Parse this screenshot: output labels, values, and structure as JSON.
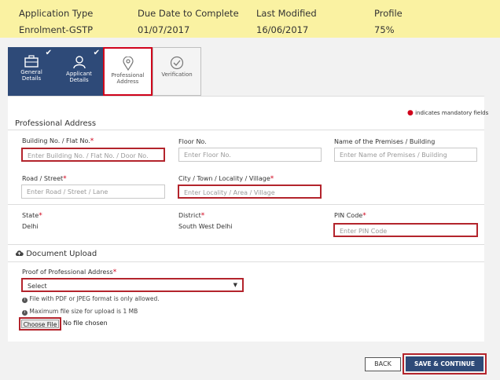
{
  "header": {
    "cols": [
      {
        "label": "Application Type",
        "value": "Enrolment-GSTP"
      },
      {
        "label": "Due Date to Complete",
        "value": "01/07/2017"
      },
      {
        "label": "Last Modified",
        "value": "16/06/2017"
      },
      {
        "label": "Profile",
        "value": "75%"
      }
    ]
  },
  "tabs": [
    {
      "line1": "General",
      "line2": "Details"
    },
    {
      "line1": "Applicant",
      "line2": "Details"
    },
    {
      "line1": "Professional",
      "line2": "Address"
    },
    {
      "line1": "Verification",
      "line2": ""
    }
  ],
  "mandatory_note": "indicates mandatory fields",
  "section_address": "Professional Address",
  "fields": {
    "building": {
      "label": "Building No. / Flat No.",
      "placeholder": "Enter Building No. / Flat No. / Door No."
    },
    "floor": {
      "label": "Floor No.",
      "placeholder": "Enter Floor No."
    },
    "premises": {
      "label": "Name of the Premises / Building",
      "placeholder": "Enter Name of Premises / Building"
    },
    "road": {
      "label": "Road / Street",
      "placeholder": "Enter Road / Street / Lane"
    },
    "city": {
      "label": "City / Town / Locality / Village",
      "placeholder": "Enter Locality / Area / Village"
    },
    "state": {
      "label": "State",
      "value": "Delhi"
    },
    "district": {
      "label": "District",
      "value": "South West Delhi"
    },
    "pin": {
      "label": "PIN Code",
      "placeholder": "Enter PIN Code"
    }
  },
  "section_upload": "Document Upload",
  "proof": {
    "label": "Proof of Professional Address",
    "selected": "Select"
  },
  "notes": {
    "format": "File with PDF or JPEG format is only allowed.",
    "size": "Maximum file size for upload is 1 MB"
  },
  "file": {
    "button": "Choose File",
    "status": "No file chosen"
  },
  "buttons": {
    "back": "BACK",
    "save": "SAVE & CONTINUE"
  },
  "colors": {
    "header_bg": "#faf2a2",
    "tab_dark": "#2e4a78",
    "highlight": "#b3242c",
    "save_bg": "#2e4a78"
  }
}
